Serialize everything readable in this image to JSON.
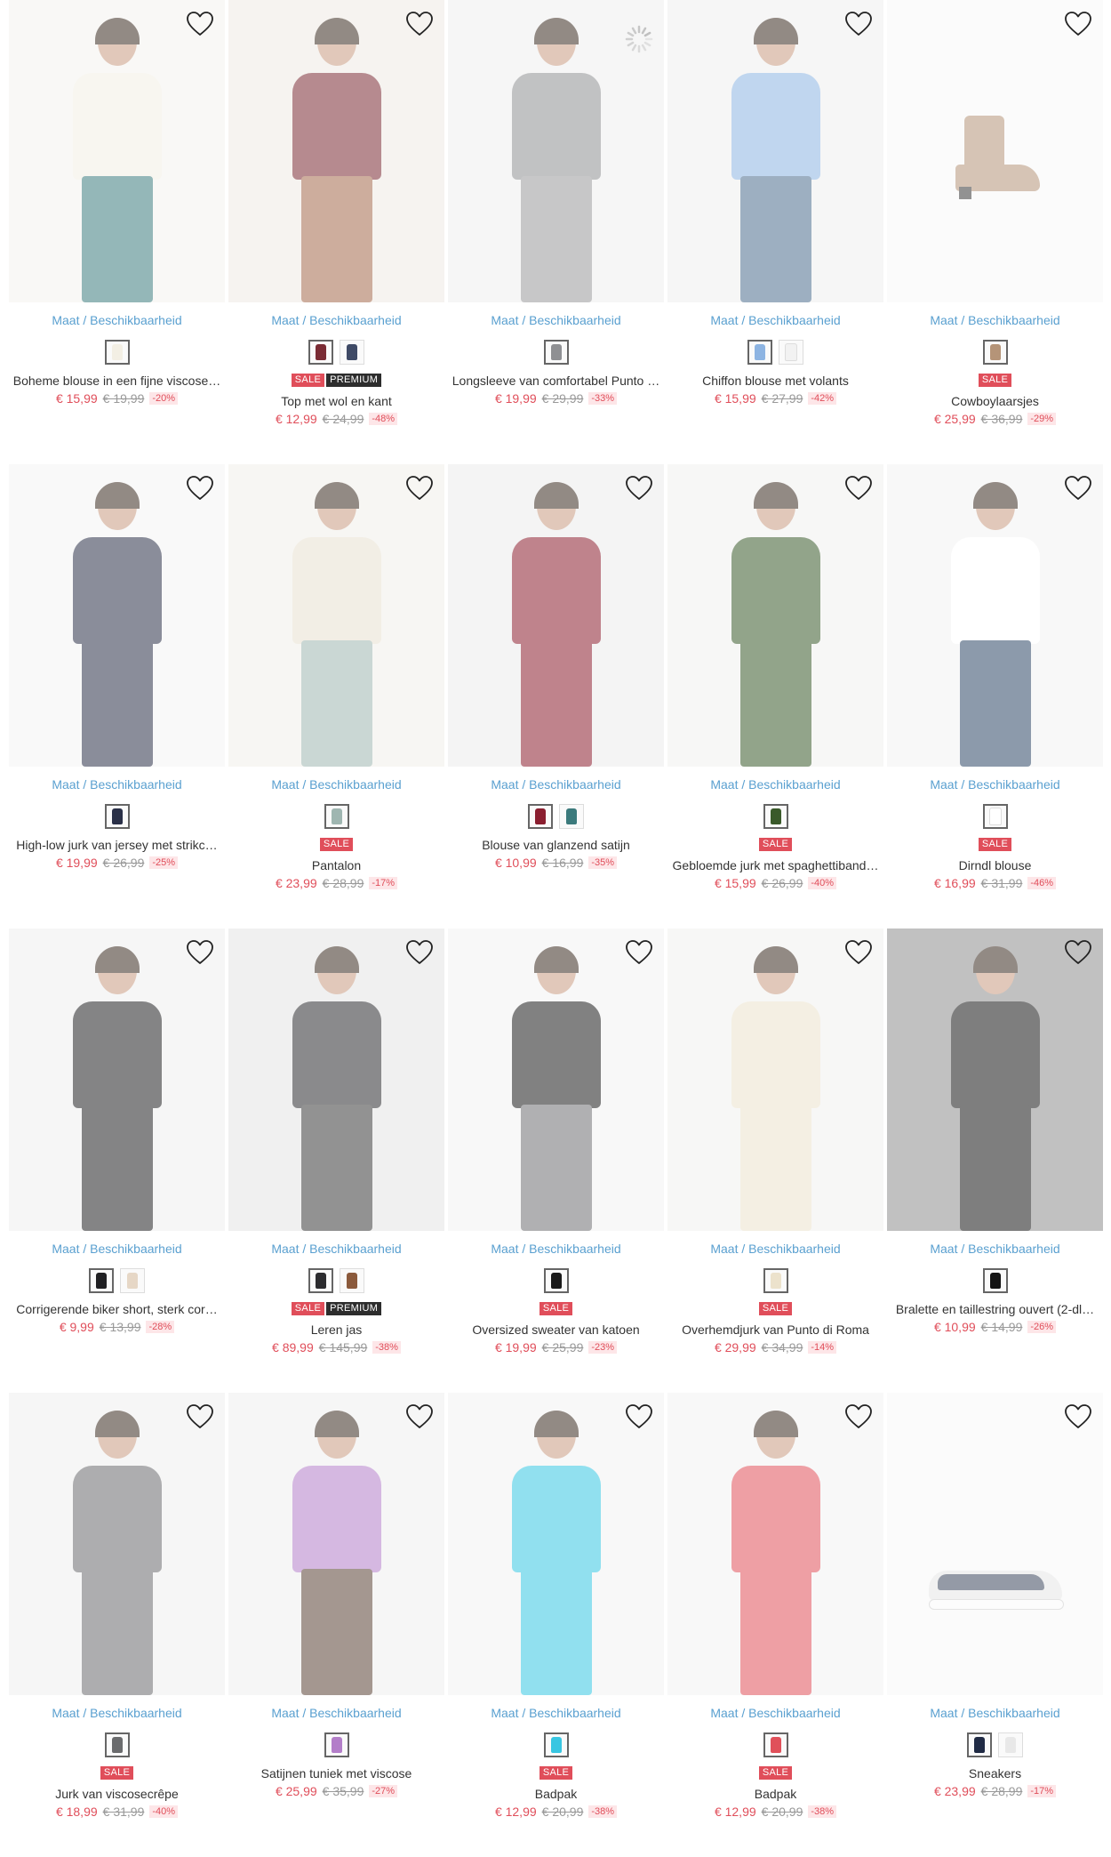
{
  "ui": {
    "size_link": "Maat / Beschikbaarheid",
    "sale_badge": "SALE",
    "premium_badge": "PREMIUM"
  },
  "products": [
    {
      "title": "Boheme blouse in een fijne viscose…",
      "price": "€ 15,99",
      "old": "€ 19,99",
      "disc": "-20%",
      "sale": false,
      "premium": false,
      "bg": "#f4f2ee",
      "cloth": "#f3efe4",
      "bottom": "#3d7d7e",
      "swatches": [
        "#f3efe4"
      ]
    },
    {
      "title": "Top met wol en kant",
      "price": "€ 12,99",
      "old": "€ 24,99",
      "disc": "-48%",
      "sale": true,
      "premium": true,
      "bg": "#efeae4",
      "cloth": "#7a2b34",
      "bottom": "#a56a4d",
      "swatches": [
        "#7a2b34",
        "#3f4a66"
      ]
    },
    {
      "title": "Longsleeve van comfortabel Punto …",
      "price": "€ 19,99",
      "old": "€ 29,99",
      "disc": "-33%",
      "sale": false,
      "premium": false,
      "bg": "#eeeeee",
      "cloth": "#8f9093",
      "bottom": "#9a9a9b",
      "swatches": [
        "#8f9093"
      ]
    },
    {
      "title": "Chiffon blouse met volants",
      "price": "€ 15,99",
      "old": "€ 27,99",
      "disc": "-42%",
      "sale": false,
      "premium": false,
      "bg": "#efefef",
      "cloth": "#8db4e2",
      "bottom": "#4d6d8e",
      "swatches": [
        "#8db4e2",
        "#f2f2f2"
      ]
    },
    {
      "title": "Cowboylaarsjes",
      "price": "€ 25,99",
      "old": "€ 36,99",
      "disc": "-29%",
      "sale": true,
      "premium": false,
      "bg": "#f7f7f7",
      "cloth": "#b59478",
      "bottom": "#b59478",
      "swatches": [
        "#b59478"
      ]
    },
    {
      "title": "High-low jurk van jersey met strikc…",
      "price": "€ 19,99",
      "old": "€ 26,99",
      "disc": "-25%",
      "sale": false,
      "premium": false,
      "bg": "#f4f4f4",
      "cloth": "#2a3048",
      "bottom": "#2a3048",
      "swatches": [
        "#2a3048"
      ]
    },
    {
      "title": "Pantalon",
      "price": "€ 23,99",
      "old": "€ 28,99",
      "disc": "-17%",
      "sale": true,
      "premium": false,
      "bg": "#f1efe9",
      "cloth": "#e8e0cf",
      "bottom": "#9fb6b1",
      "swatches": [
        "#9fb6b1"
      ]
    },
    {
      "title": "Blouse van glanzend satijn",
      "price": "€ 10,99",
      "old": "€ 16,99",
      "disc": "-35%",
      "sale": false,
      "premium": false,
      "bg": "#ececec",
      "cloth": "#8a1e2f",
      "bottom": "#8a1e2f",
      "swatches": [
        "#8a1e2f",
        "#3b7a7c"
      ]
    },
    {
      "title": "Gebloemde jurk met spaghettiband…",
      "price": "€ 15,99",
      "old": "€ 26,99",
      "disc": "-40%",
      "sale": true,
      "premium": false,
      "bg": "#f0f0ee",
      "cloth": "#3a5a2a",
      "bottom": "#3a5a2a",
      "swatches": [
        "#3a5a2a"
      ]
    },
    {
      "title": "Dirndl blouse",
      "price": "€ 16,99",
      "old": "€ 31,99",
      "disc": "-46%",
      "sale": true,
      "premium": false,
      "bg": "#f2f2f2",
      "cloth": "#ffffff",
      "bottom": "#2e4766",
      "swatches": [
        "#ffffff"
      ]
    },
    {
      "title": "Corrigerende biker short, sterk cor…",
      "price": "€ 9,99",
      "old": "€ 13,99",
      "disc": "-28%",
      "sale": false,
      "premium": false,
      "bg": "#eeeeee",
      "cloth": "#1f1f22",
      "bottom": "#1f1f22",
      "swatches": [
        "#1f1f22",
        "#e6d7c6"
      ]
    },
    {
      "title": "Leren jas",
      "price": "€ 89,99",
      "old": "€ 145,99",
      "disc": "-38%",
      "sale": true,
      "premium": true,
      "bg": "#e3e3e3",
      "cloth": "#2b2b2e",
      "bottom": "#3a3a3a",
      "swatches": [
        "#2b2b2e",
        "#8b5a3c"
      ]
    },
    {
      "title": "Oversized sweater van katoen",
      "price": "€ 19,99",
      "old": "€ 25,99",
      "disc": "-23%",
      "sale": true,
      "premium": false,
      "bg": "#f3f3f3",
      "cloth": "#1a1a1a",
      "bottom": "#6f6f73",
      "swatches": [
        "#1a1a1a"
      ]
    },
    {
      "title": "Overhemdjurk van Punto di Roma",
      "price": "€ 29,99",
      "old": "€ 34,99",
      "disc": "-14%",
      "sale": true,
      "premium": false,
      "bg": "#f1f1ef",
      "cloth": "#ece2cc",
      "bottom": "#ece2cc",
      "swatches": [
        "#ece2cc"
      ]
    },
    {
      "title": "Bralette en taillestring ouvert (2-dl…",
      "price": "€ 10,99",
      "old": "€ 14,99",
      "disc": "-26%",
      "sale": false,
      "premium": false,
      "bg": "#8e8e8e",
      "cloth": "#141414",
      "bottom": "#141414",
      "swatches": [
        "#141414"
      ]
    },
    {
      "title": "Jurk van viscosecrêpe",
      "price": "€ 18,99",
      "old": "€ 31,99",
      "disc": "-40%",
      "sale": true,
      "premium": false,
      "bg": "#eeeeee",
      "cloth": "#6a6b6d",
      "bottom": "#6a6b6d",
      "swatches": [
        "#6a6b6d"
      ]
    },
    {
      "title": "Satijnen tuniek met viscose",
      "price": "€ 25,99",
      "old": "€ 35,99",
      "disc": "-27%",
      "sale": false,
      "premium": false,
      "bg": "#eeeeee",
      "cloth": "#b37ec9",
      "bottom": "#5a4235",
      "swatches": [
        "#b37ec9"
      ]
    },
    {
      "title": "Badpak",
      "price": "€ 12,99",
      "old": "€ 20,99",
      "disc": "-38%",
      "sale": true,
      "premium": false,
      "bg": "#f2f2f2",
      "cloth": "#38c6e2",
      "bottom": "#38c6e2",
      "swatches": [
        "#38c6e2"
      ]
    },
    {
      "title": "Badpak",
      "price": "€ 12,99",
      "old": "€ 20,99",
      "disc": "-38%",
      "sale": true,
      "premium": false,
      "bg": "#f2f2f2",
      "cloth": "#e0505a",
      "bottom": "#e0505a",
      "swatches": [
        "#e0505a"
      ]
    },
    {
      "title": "Sneakers",
      "price": "€ 23,99",
      "old": "€ 28,99",
      "disc": "-17%",
      "sale": false,
      "premium": false,
      "bg": "#f7f7f7",
      "cloth": "#5e6a8a",
      "bottom": "#5e6a8a",
      "swatches": [
        "#1f2a44",
        "#e8e8e8"
      ]
    }
  ]
}
